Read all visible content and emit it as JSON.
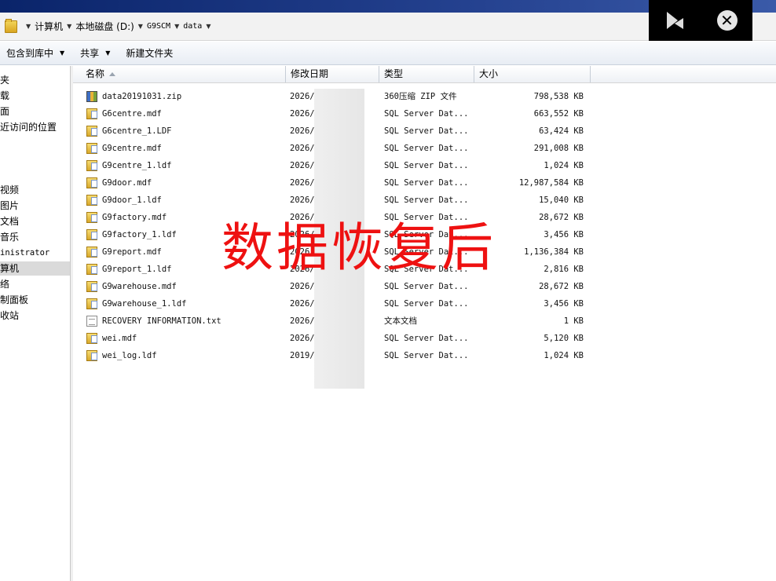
{
  "address": {
    "path": [
      "计算机",
      "本地磁盘 (D:)",
      "G9SCM",
      "data"
    ]
  },
  "toolbar": {
    "include_library": "包含到库中",
    "share": "共享",
    "new_folder": "新建文件夹"
  },
  "nav": {
    "items": [
      "夹",
      "载",
      "面",
      "近访问的位置",
      "视频",
      "图片",
      "文档",
      "音乐",
      "inistrator",
      "算机",
      "络",
      "制面板",
      "收站"
    ],
    "selected": "算机"
  },
  "columns": {
    "name": "名称",
    "date": "修改日期",
    "type": "类型",
    "size": "大小"
  },
  "files": [
    {
      "name": "data20191031.zip",
      "date": "2026/",
      "type": "360压缩 ZIP 文件",
      "size": "798,538 KB",
      "icon": "zip-file-icon"
    },
    {
      "name": "G6centre.mdf",
      "date": "2026/",
      "type": "SQL Server Dat...",
      "size": "663,552 KB",
      "icon": "database-file-icon"
    },
    {
      "name": "G6centre_1.LDF",
      "date": "2026/",
      "type": "SQL Server Dat...",
      "size": "63,424 KB",
      "icon": "database-file-icon"
    },
    {
      "name": "G9centre.mdf",
      "date": "2026/",
      "type": "SQL Server Dat...",
      "size": "291,008 KB",
      "icon": "database-file-icon"
    },
    {
      "name": "G9centre_1.ldf",
      "date": "2026/",
      "type": "SQL Server Dat...",
      "size": "1,024 KB",
      "icon": "database-file-icon"
    },
    {
      "name": "G9door.mdf",
      "date": "2026/",
      "type": "SQL Server Dat...",
      "size": "12,987,584 KB",
      "icon": "database-file-icon"
    },
    {
      "name": "G9door_1.ldf",
      "date": "2026/",
      "type": "SQL Server Dat...",
      "size": "15,040 KB",
      "icon": "database-file-icon"
    },
    {
      "name": "G9factory.mdf",
      "date": "2026/",
      "type": "SQL Server Dat...",
      "size": "28,672 KB",
      "icon": "database-file-icon"
    },
    {
      "name": "G9factory_1.ldf",
      "date": "2026/",
      "type": "SQL Server Dat...",
      "size": "3,456 KB",
      "icon": "database-file-icon"
    },
    {
      "name": "G9report.mdf",
      "date": "2026/",
      "type": "SQL Server Dat...",
      "size": "1,136,384 KB",
      "icon": "database-file-icon"
    },
    {
      "name": "G9report_1.ldf",
      "date": "2026/",
      "type": "SQL Server Dat...",
      "size": "2,816 KB",
      "icon": "database-file-icon"
    },
    {
      "name": "G9warehouse.mdf",
      "date": "2026/",
      "type": "SQL Server Dat...",
      "size": "28,672 KB",
      "icon": "database-file-icon"
    },
    {
      "name": "G9warehouse_1.ldf",
      "date": "2026/",
      "type": "SQL Server Dat...",
      "size": "3,456 KB",
      "icon": "database-file-icon"
    },
    {
      "name": "RECOVERY INFORMATION.txt",
      "date": "2026/",
      "type": "文本文档",
      "size": "1 KB",
      "icon": "text-file-icon"
    },
    {
      "name": "wei.mdf",
      "date": "2026/",
      "type": "SQL Server Dat...",
      "size": "5,120 KB",
      "icon": "database-file-icon"
    },
    {
      "name": "wei_log.ldf",
      "date": "2019/",
      "type": "SQL Server Dat...",
      "size": "1,024 KB",
      "icon": "database-file-icon"
    }
  ],
  "watermark": "数据恢复后",
  "colors": {
    "watermark": "#ee1111",
    "titlebar": "#0a246a"
  }
}
